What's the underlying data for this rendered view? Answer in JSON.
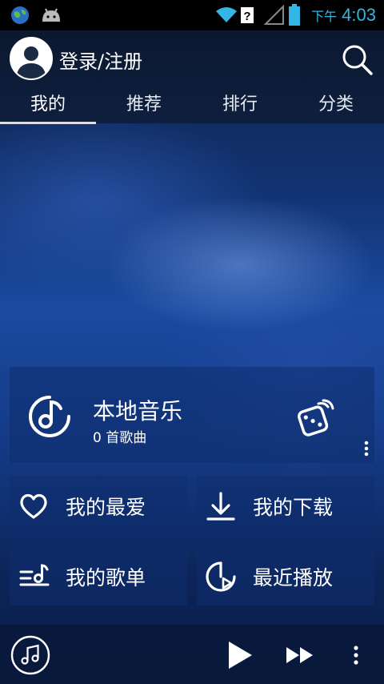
{
  "status_bar": {
    "ampm": "下午",
    "time": "4:03"
  },
  "header": {
    "login_label": "登录/注册",
    "tabs": [
      {
        "label": "我的"
      },
      {
        "label": "推荐"
      },
      {
        "label": "排行"
      },
      {
        "label": "分类"
      }
    ],
    "active_tab": "我的"
  },
  "local_music": {
    "title": "本地音乐",
    "count": "0 首歌曲"
  },
  "tiles": [
    {
      "label": "我的最爱",
      "icon": "heart-icon"
    },
    {
      "label": "我的下载",
      "icon": "download-icon"
    },
    {
      "label": "我的歌单",
      "icon": "playlist-icon"
    },
    {
      "label": "最近播放",
      "icon": "recent-play-icon"
    }
  ],
  "colors": {
    "status_accent": "#33b5e5",
    "tile_bg": "rgba(15,45,110,0.55)"
  }
}
